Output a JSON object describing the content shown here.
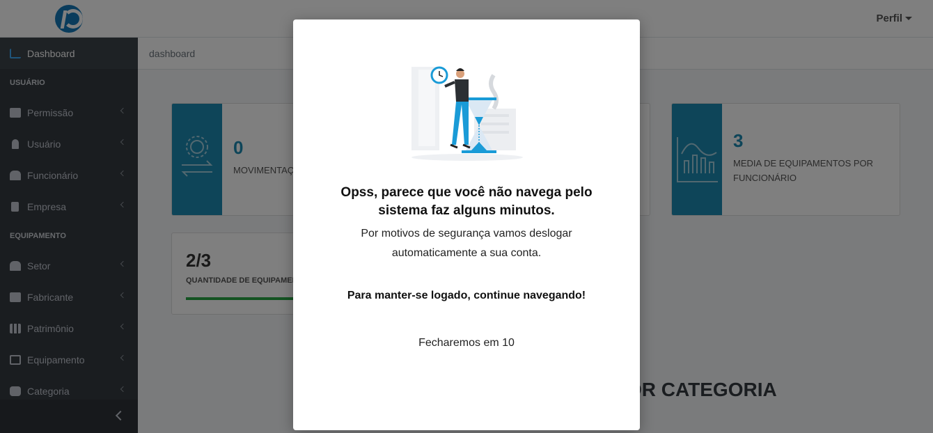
{
  "header": {
    "profile_label": "Perfil"
  },
  "sidebar": {
    "dashboard": "Dashboard",
    "section_user": "USUÁRIO",
    "section_equipment": "EQUIPAMENTO",
    "items_user": [
      {
        "label": "Permissão",
        "icon": "id-card-icon"
      },
      {
        "label": "Usuário",
        "icon": "user-icon"
      },
      {
        "label": "Funcionário",
        "icon": "users-icon"
      },
      {
        "label": "Empresa",
        "icon": "building-icon"
      }
    ],
    "items_equipment": [
      {
        "label": "Setor",
        "icon": "users-icon"
      },
      {
        "label": "Fabricante",
        "icon": "box-icon"
      },
      {
        "label": "Patrimônio",
        "icon": "grid-icon"
      },
      {
        "label": "Equipamento",
        "icon": "desktop-icon"
      },
      {
        "label": "Categoria",
        "icon": "cubes-icon"
      }
    ]
  },
  "breadcrumb": "dashboard",
  "cards": {
    "movements": {
      "value": "0",
      "label": "MOVIMENTAÇ"
    },
    "avg": {
      "value": "3",
      "label_line1": "MEDIA DE EQUIPAMENTOS POR",
      "label_line2": "FUNCIONÁRIO"
    },
    "quantity": {
      "value": "2/3",
      "label": "QUANTIDADE DE EQUIPAMEN"
    }
  },
  "section_title": "OR CATEGORIA",
  "modal": {
    "title_line1": "Opss, parece que você não navega pelo",
    "title_line2": "sistema faz alguns minutos.",
    "sub_line1": "Por motivos de segurança vamos deslogar",
    "sub_line2": "automaticamente a sua conta.",
    "bold": "Para manter-se logado, continue navegando!",
    "countdown": "Fecharemos em 10"
  },
  "colors": {
    "accent": "#1c8bb3",
    "sidebar": "#343a40",
    "progress": "#28a745"
  }
}
